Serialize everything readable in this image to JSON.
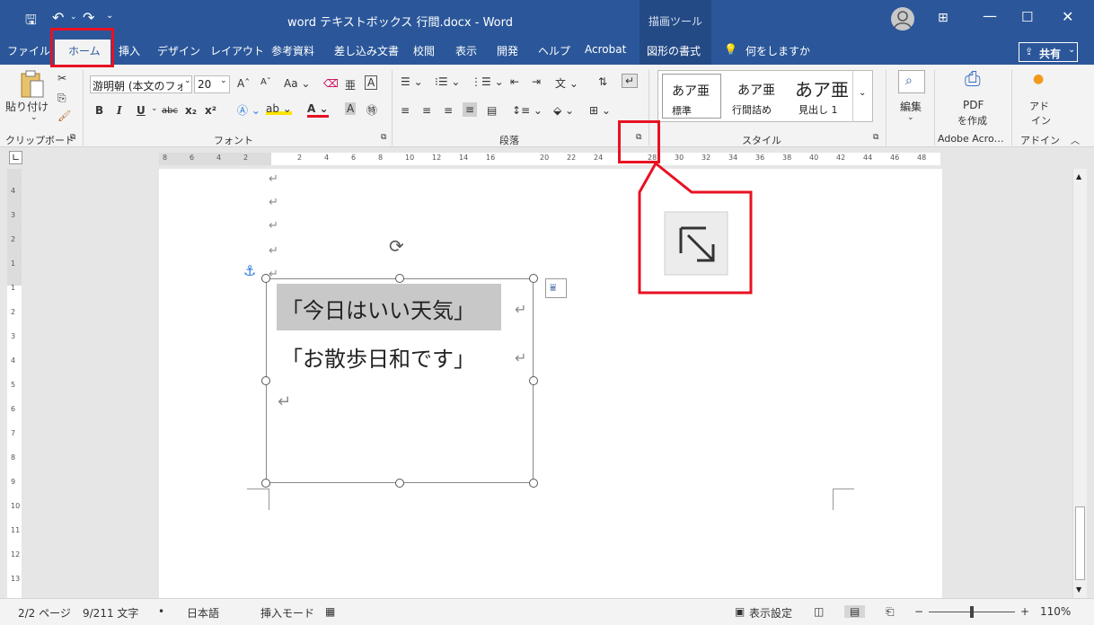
{
  "titlebar": {
    "title": "word テキストボックス 行間.docx - Word",
    "context_tab": "描画ツール"
  },
  "tabs": [
    "ファイル",
    "ホーム",
    "挿入",
    "デザイン",
    "レイアウト",
    "参考資料",
    "差し込み文書",
    "校閲",
    "表示",
    "開発",
    "ヘルプ",
    "Acrobat",
    "図形の書式"
  ],
  "tell_me": "何をしますか",
  "share": "共有",
  "clipboard": {
    "paste": "貼り付け",
    "label": "クリップボード"
  },
  "font": {
    "name": "游明朝 (本文のフォント)",
    "size": "20",
    "label": "フォント"
  },
  "paragraph": {
    "label": "段落"
  },
  "styles": {
    "items": [
      {
        "sample": "あア亜",
        "name": "標準"
      },
      {
        "sample": "あア亜",
        "name": "行間詰め"
      },
      {
        "sample": "あア亜",
        "name": "見出し 1"
      }
    ],
    "label": "スタイル"
  },
  "editing": {
    "label": "編集"
  },
  "pdf": {
    "line1": "PDF",
    "line2": "を作成",
    "group": "Adobe Acro…"
  },
  "addin": {
    "line1": "アド",
    "line2": "イン",
    "group": "アドイン"
  },
  "ruler_ticks": [
    "8",
    "6",
    "4",
    "2",
    "",
    "2",
    "4",
    "6",
    "8",
    "10",
    "12",
    "14",
    "16",
    "",
    "20",
    "22",
    "24",
    "",
    "28",
    "30",
    "32",
    "34",
    "36",
    "38",
    "40",
    "42",
    "44",
    "46",
    "48"
  ],
  "vruler_ticks": [
    "4",
    "3",
    "2",
    "1",
    "1",
    "2",
    "3",
    "4",
    "5",
    "6",
    "7",
    "8",
    "9",
    "10",
    "11",
    "12",
    "13"
  ],
  "doc": {
    "line1": "「今日はいい天気」",
    "line2": "「お散歩日和です」"
  },
  "status": {
    "page": "2/2 ページ",
    "words": "9/211 文字",
    "lang": "日本語",
    "mode": "挿入モード",
    "display": "表示設定",
    "zoom": "110%"
  },
  "colors": {
    "accent": "#2b579a",
    "highlight": "#e81123"
  }
}
